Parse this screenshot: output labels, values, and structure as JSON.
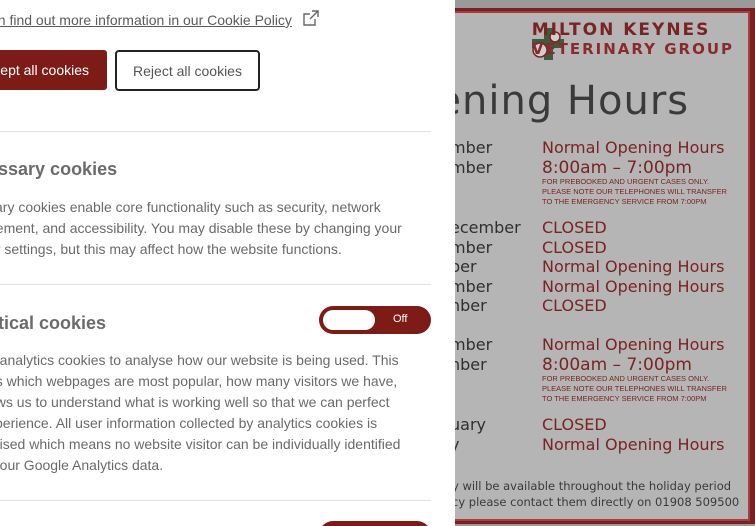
{
  "cookie_panel": {
    "policy_link": "an find out more information in our Cookie Policy",
    "accept_label": "ept all cookies",
    "reject_label": "Reject all cookies",
    "necessary": {
      "heading": "essary cookies",
      "lines": [
        "sary cookies enable core functionality such as security, network",
        "gement, and accessibility. You may disable these by changing your",
        "er settings, but this may affect how the website functions."
      ]
    },
    "analytical": {
      "heading": "ytical cookies",
      "toggle_state": "Off",
      "lines": [
        "e analytics cookies to analyse how our website is being used. This",
        "es which webpages are most popular, how many visitors we have,",
        "ows us to understand what is working well so that we can perfect",
        "xperience. All user information collected by analytics cookies is",
        "mised which means no website visitor can be individually identified",
        "h our Google Analytics data."
      ]
    }
  },
  "poster": {
    "brand_line1": "MILTON KEYNES",
    "brand_line2": "VETERINARY GROUP",
    "title": "pening Hours",
    "rows": [
      {
        "date": "mber",
        "value": "Normal Opening Hours"
      },
      {
        "date": "mber",
        "value": "8:00am – 7:00pm"
      },
      {
        "date": "ecember",
        "value": "CLOSED"
      },
      {
        "date": "mber",
        "value": "CLOSED"
      },
      {
        "date": "ber",
        "value": "Normal Opening Hours"
      },
      {
        "date": "mber",
        "value": "Normal Opening Hours"
      },
      {
        "date": "nber",
        "value": "CLOSED"
      },
      {
        "date": "mber",
        "value": "Normal Opening Hours"
      },
      {
        "date": "nber",
        "value": "8:00am – 7:00pm"
      },
      {
        "date": "uary",
        "value": "CLOSED"
      },
      {
        "date": "y",
        "value": "Normal Opening Hours"
      }
    ],
    "note": "FOR PREBOOKED AND URGENT CASES ONLY. PLEASE NOTE OUR TELEPHONES WILL TRANSFER TO THE EMERGENCY SERVICE FROM 7:00pm",
    "footer1": "y will be available throughout the holiday period",
    "footer2": "cy please contact them directly on 01908 509500"
  }
}
